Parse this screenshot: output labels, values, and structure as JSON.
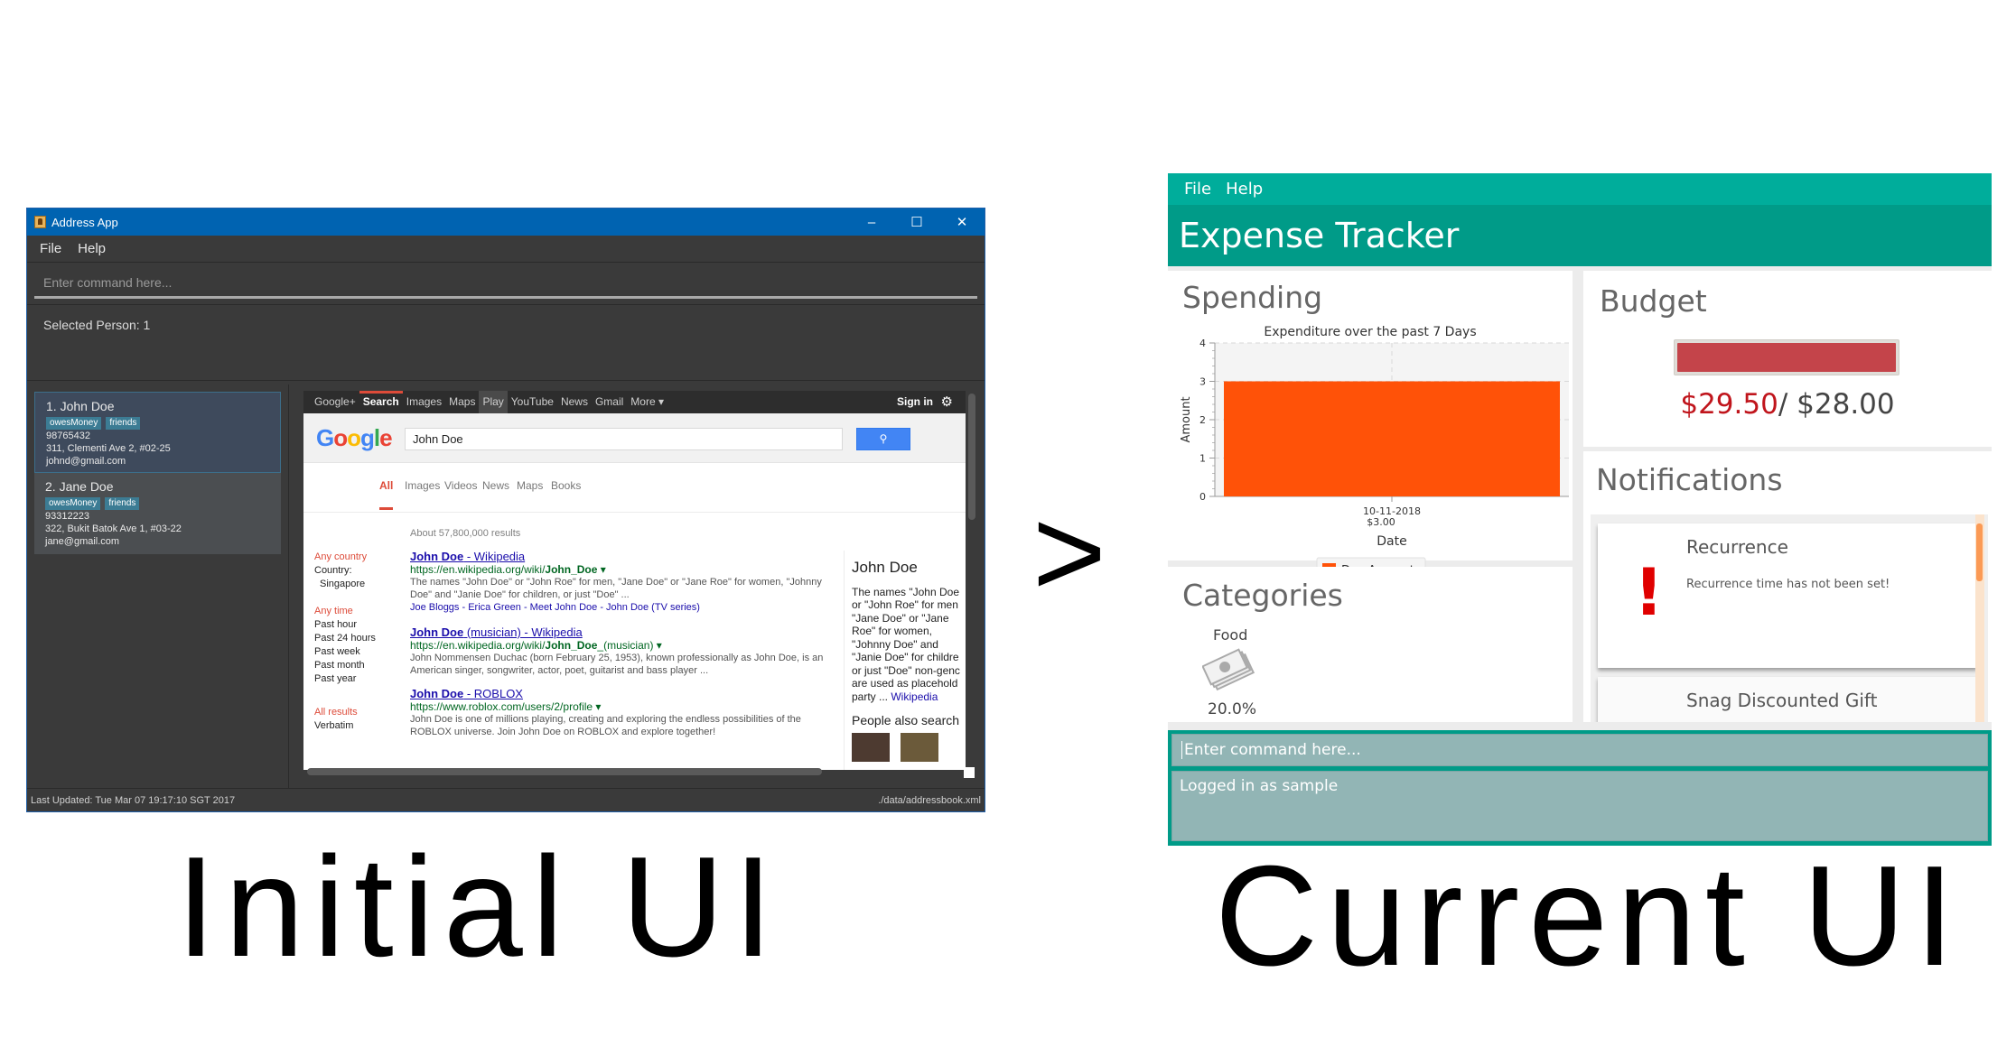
{
  "captions": {
    "arrow": ">",
    "initial": "Initial UI",
    "current": "Current UI"
  },
  "address_app": {
    "window_title": "Address App",
    "window_controls": {
      "minimize": "–",
      "maximize": "☐",
      "close": "✕"
    },
    "menu": [
      "File",
      "Help"
    ],
    "command_placeholder": "Enter command here...",
    "result_text": "Selected Person: 1",
    "persons": [
      {
        "name": "1. John Doe",
        "tags": [
          "owesMoney",
          "friends"
        ],
        "phone": "98765432",
        "address": "311, Clementi Ave 2, #02-25",
        "email": "johnd@gmail.com",
        "selected": true
      },
      {
        "name": "2. Jane Doe",
        "tags": [
          "owesMoney",
          "friends"
        ],
        "phone": "93312223",
        "address": "322, Bukit Batok Ave 1, #03-22",
        "email": "jane@gmail.com",
        "selected": false
      }
    ],
    "browser": {
      "top_bar": [
        "Google+",
        "Search",
        "Images",
        "Maps",
        "Play",
        "YouTube",
        "News",
        "Gmail",
        "More ▾"
      ],
      "active_top": "Search",
      "sign_in": "Sign in",
      "logo": "Google",
      "logo_colors": [
        "#4285f4",
        "#ea4335",
        "#fbbc05",
        "#4285f4",
        "#34a853",
        "#ea4335"
      ],
      "query": "John Doe",
      "search_button_icon": "magnifier",
      "tabs": [
        "All",
        "Images",
        "Videos",
        "News",
        "Maps",
        "Books"
      ],
      "active_tab": "All",
      "result_count": "About 57,800,000 results",
      "filters": {
        "country_heading": "Any country",
        "country_label": "Country:",
        "country_value": "Singapore",
        "time_heading": "Any time",
        "time_options": [
          "Past hour",
          "Past 24 hours",
          "Past week",
          "Past month",
          "Past year"
        ],
        "results_heading": "All results",
        "results_options": [
          "Verbatim"
        ]
      },
      "results": [
        {
          "title_bold": "John Doe",
          "title_rest": " - Wikipedia",
          "url_prefix": "https://en.wikipedia.org/wiki/",
          "url_bold": "John_Doe",
          "url_suffix": "",
          "snippet": "The names \"John Doe\" or \"John Roe\" for men, \"Jane Doe\" or \"Jane Roe\" for women, \"Johnny Doe\" and \"Janie Doe\" for children, or just \"Doe\" ...",
          "sublinks": "Joe Bloggs - Erica Green - Meet John Doe - John Doe (TV series)"
        },
        {
          "title_bold": "John Doe",
          "title_rest": " (musician) - Wikipedia",
          "url_prefix": "https://en.wikipedia.org/wiki/",
          "url_bold": "John_Doe",
          "url_suffix": "_(musician)",
          "snippet": "John Nommensen Duchac (born February 25, 1953), known professionally as John Doe, is an American singer, songwriter, actor, poet, guitarist and bass player ...",
          "sublinks": ""
        },
        {
          "title_bold": "John Doe",
          "title_rest": " - ROBLOX",
          "url_prefix": "https://www.roblox.com/users/2/profile",
          "url_bold": "",
          "url_suffix": "",
          "snippet": "John Doe is one of millions playing, creating and exploring the endless possibilities of the ROBLOX universe. Join John Doe on ROBLOX and explore together!",
          "sublinks": ""
        }
      ],
      "knowledge_panel": {
        "title": "John Doe",
        "lines": [
          "The names \"John Doe",
          "or \"John Roe\" for men",
          "\"Jane Doe\" or \"Jane",
          "Roe\" for women,",
          "\"Johnny Doe\" and",
          "\"Janie Doe\" for childre",
          "or just \"Doe\" non-genc",
          "are used as placehold"
        ],
        "last_line": "party ... ",
        "link": "Wikipedia",
        "people_also_search": "People also search"
      }
    },
    "status_left": "Last Updated: Tue Mar 07 19:17:10 SGT 2017",
    "status_right": "./data/addressbook.xml"
  },
  "expense_tracker": {
    "menu": [
      "File",
      "Help"
    ],
    "title": "Expense Tracker",
    "spending": {
      "heading": "Spending"
    },
    "budget": {
      "heading": "Budget",
      "spent": "$29.50",
      "separator": "/ ",
      "total": "$28.00",
      "fill_fraction": 1.0,
      "bar_color": "#c4444a"
    },
    "notifications": {
      "heading": "Notifications",
      "items": [
        {
          "title": "Recurrence",
          "body": "Recurrence time has not been set!",
          "icon": "exclamation-icon"
        },
        {
          "title": "Snag Discounted Gift",
          "body": ""
        }
      ]
    },
    "categories": {
      "heading": "Categories",
      "items": [
        {
          "name": "Food",
          "icon": "money-bills-icon",
          "percent": "20.0%"
        }
      ]
    },
    "command_placeholder": "Enter command here...",
    "result_text": "Logged in as sample",
    "colors": {
      "menu": "#00ad9b",
      "title": "#009b88",
      "command_bg": "#92b5b5",
      "bar": "#ff5208"
    }
  },
  "chart_data": {
    "type": "bar",
    "title": "Expenditure over the past 7 Days",
    "xlabel": "Date",
    "ylabel": "Amount",
    "categories": [
      "10-11-2018\n$3.00"
    ],
    "category_lines": [
      [
        "10-11-2018",
        "$3.00"
      ]
    ],
    "series": [
      {
        "name": "Day Amounts",
        "values": [
          3
        ],
        "color": "#ff5208"
      }
    ],
    "ylim": [
      0,
      4
    ],
    "yticks": [
      0,
      1,
      2,
      3,
      4
    ],
    "grid": true,
    "legend": "bottom-center"
  }
}
